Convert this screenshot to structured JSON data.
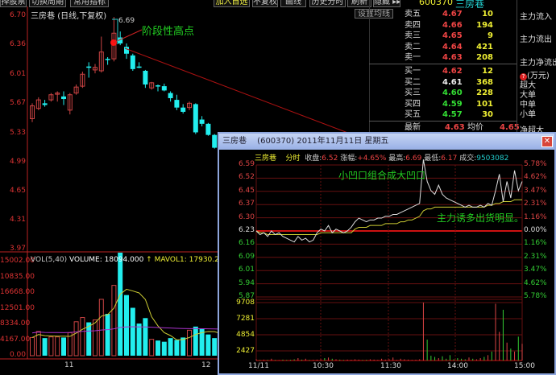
{
  "toolbar": {
    "select_stock": "择股票",
    "switch_period": "切换周期",
    "common_indicators": "常用指标",
    "add_favorite": "加入自选",
    "no_adjust": "不复权",
    "draw_line": "画线",
    "history_intraday": "历史分时",
    "refresh": "刷新",
    "hide": "隐藏 ▸▸",
    "set_ma": "设置均线"
  },
  "kline": {
    "title": "三房巷",
    "subtitle": "(日线,下复权)",
    "high_label": "6.69",
    "annotation": "阶段性高点",
    "y_ticks": [
      "6.70",
      "6.36",
      "6.01",
      "5.67",
      "5.33",
      "4.99",
      "4.65",
      "4.31",
      "3.97"
    ],
    "x_ticks": [
      "11",
      "12"
    ],
    "candles": [
      [
        5.5,
        5.65,
        5.68,
        5.46
      ],
      [
        5.62,
        5.72,
        5.75,
        5.6
      ],
      [
        5.68,
        5.66,
        5.72,
        5.64
      ],
      [
        5.72,
        5.78,
        5.8,
        5.7
      ],
      [
        5.79,
        5.8,
        5.82,
        5.7
      ],
      [
        5.76,
        5.73,
        5.82,
        5.66
      ],
      [
        5.6,
        5.78,
        5.8,
        5.55
      ],
      [
        5.8,
        5.87,
        5.9,
        5.78
      ],
      [
        5.88,
        6.02,
        6.05,
        5.86
      ],
      [
        6.11,
        6.1,
        6.16,
        5.98
      ],
      [
        6.07,
        6.1,
        6.14,
        6.03
      ],
      [
        6.06,
        6.28,
        6.46,
        6.04
      ],
      [
        6.2,
        6.19,
        6.22,
        6.13
      ],
      [
        6.2,
        6.5,
        6.69,
        6.17
      ],
      [
        6.45,
        6.38,
        6.52,
        6.36
      ],
      [
        6.34,
        6.26,
        6.38,
        6.2
      ],
      [
        6.24,
        6.08,
        6.26,
        6.06
      ],
      [
        6.11,
        6.1,
        6.16,
        6.09
      ],
      [
        6.06,
        5.9,
        6.07,
        5.86
      ],
      [
        5.86,
        5.92,
        5.93,
        5.84
      ],
      [
        5.89,
        5.88,
        5.9,
        5.82
      ],
      [
        5.88,
        5.83,
        5.91,
        5.82
      ],
      [
        5.8,
        5.74,
        5.82,
        5.7
      ],
      [
        5.72,
        5.63,
        5.78,
        5.6
      ],
      [
        5.63,
        5.58,
        5.67,
        5.56
      ],
      [
        5.63,
        5.68,
        5.7,
        5.6
      ],
      [
        5.67,
        5.34,
        5.68,
        5.32
      ],
      [
        5.49,
        5.44,
        5.53,
        5.41
      ],
      [
        5.44,
        5.31,
        5.45,
        5.3
      ],
      [
        5.31,
        5.16,
        5.32,
        5.15
      ],
      [
        5.2,
        5.26,
        5.28,
        5.15
      ]
    ]
  },
  "volume": {
    "title": "VOL(5,40)",
    "volume_label": "VOLUME: 18094.000",
    "mavol_label": "MAVOL1: 17930.200",
    "y_ticks": [
      "15002.00",
      "10835.00",
      "16668.00",
      "12501.00",
      "8334.00",
      "4167.00",
      "0.00"
    ],
    "values": [
      3000,
      4000,
      2900,
      3100,
      3100,
      3000,
      3800,
      5600,
      6300,
      5500,
      5900,
      9300,
      6900,
      11600,
      17000,
      10000,
      7900,
      5300,
      6200,
      2700,
      2500,
      2300,
      2900,
      2600,
      3000,
      4200,
      4800,
      4400,
      3500,
      2900,
      2700
    ]
  },
  "quote": {
    "code": "600370",
    "name": "三房巷",
    "asks": [
      {
        "label": "卖五",
        "price": "4.67",
        "vol": "10"
      },
      {
        "label": "卖四",
        "price": "4.66",
        "vol": "194"
      },
      {
        "label": "卖三",
        "price": "4.65",
        "vol": "9"
      },
      {
        "label": "卖二",
        "price": "4.64",
        "vol": "421"
      },
      {
        "label": "卖一",
        "price": "4.63",
        "vol": "208"
      }
    ],
    "bids": [
      {
        "label": "买一",
        "price": "4.62",
        "vol": "12"
      },
      {
        "label": "买二",
        "price": "4.61",
        "vol": "368"
      },
      {
        "label": "买三",
        "price": "4.60",
        "vol": "228"
      },
      {
        "label": "买四",
        "price": "4.59",
        "vol": "101"
      },
      {
        "label": "买五",
        "price": "4.57",
        "vol": "30"
      }
    ],
    "latest_label": "最新",
    "latest": "4.63",
    "avg_label": "均价",
    "avg": "4.65",
    "flow": {
      "in": "主力流入",
      "out": "主力流出",
      "net": "主力净流出",
      "unit": "(万元)",
      "super": "超大",
      "big": "大单",
      "mid": "中单",
      "small": "小单",
      "net_super": "净超大"
    }
  },
  "popup": {
    "title": "三房巷 　(600370) 2011年11月11日 星期五",
    "close_label": "✕",
    "info": {
      "name": "三房巷",
      "mode": "分时",
      "close_label": "收盘:",
      "close": "6.52",
      "chg_label": "涨幅:",
      "chg": "+4.65%",
      "high_label": "最高:",
      "high": "6.69",
      "low_label": "最低:",
      "low": "6.17",
      "vol_label": "成交:",
      "vol": "9503082"
    },
    "annot1": "小凹口组合成大凹口",
    "annot2": "主力诱多出货明显。"
  },
  "chart_data": {
    "type": "line",
    "title": "三房巷 分时 2011年11月11日",
    "y_ticks": [
      "6.59",
      "6.52",
      "6.45",
      "6.37",
      "6.30",
      "6.23",
      "6.16",
      "6.09",
      "6.01",
      "5.94",
      "5.87"
    ],
    "pct_ticks": [
      "5.78%",
      "4.62%",
      "3.47%",
      "2.31%",
      "1.16%",
      "0.00%",
      "1.16%",
      "2.31%",
      "3.47%",
      "4.62%",
      "5.78%"
    ],
    "vol_ticks": [
      "9708",
      "7281",
      "4854",
      "2427"
    ],
    "x_ticks": [
      "11/11",
      "10:30",
      "11:30",
      "14:00",
      "15:00"
    ],
    "pre_close": 6.23,
    "price": [
      6.23,
      6.21,
      6.22,
      6.2,
      6.23,
      6.21,
      6.22,
      6.2,
      6.19,
      6.18,
      6.17,
      6.2,
      6.18,
      6.19,
      6.17,
      6.18,
      6.22,
      6.24,
      6.23,
      6.26,
      6.22,
      6.24,
      6.23,
      6.22,
      6.23,
      6.25,
      6.28,
      6.3,
      6.29,
      6.28,
      6.29,
      6.29,
      6.3,
      6.3,
      6.31,
      6.31,
      6.32,
      6.32,
      6.33,
      6.34,
      6.35,
      6.36,
      6.37,
      6.38,
      6.62,
      6.5,
      6.45,
      6.43,
      6.48,
      6.43,
      6.41,
      6.4,
      6.39,
      6.38,
      6.37,
      6.36,
      6.37,
      6.36,
      6.36,
      6.37,
      6.36,
      6.38,
      6.37,
      6.45,
      6.54,
      6.39,
      6.5,
      6.41,
      6.56,
      6.45,
      6.5
    ],
    "avg": [
      6.23,
      6.22,
      6.22,
      6.21,
      6.21,
      6.21,
      6.21,
      6.21,
      6.21,
      6.21,
      6.21,
      6.21,
      6.21,
      6.21,
      6.21,
      6.21,
      6.21,
      6.22,
      6.22,
      6.22,
      6.22,
      6.22,
      6.22,
      6.22,
      6.22,
      6.22,
      6.24,
      6.25,
      6.25,
      6.25,
      6.26,
      6.26,
      6.26,
      6.26,
      6.27,
      6.27,
      6.27,
      6.27,
      6.28,
      6.28,
      6.29,
      6.29,
      6.3,
      6.31,
      6.34,
      6.35,
      6.35,
      6.36,
      6.36,
      6.36,
      6.36,
      6.36,
      6.36,
      6.36,
      6.36,
      6.36,
      6.36,
      6.36,
      6.36,
      6.36,
      6.36,
      6.37,
      6.37,
      6.38,
      6.38,
      6.39,
      6.39,
      6.39,
      6.4,
      6.4,
      6.4
    ],
    "volume": [
      200,
      100,
      150,
      120,
      300,
      100,
      80,
      150,
      100,
      120,
      200,
      400,
      150,
      300,
      100,
      120,
      150,
      200,
      400,
      500,
      300,
      200,
      150,
      100,
      150,
      120,
      200,
      150,
      100,
      120,
      200,
      150,
      100,
      300,
      150,
      200,
      500,
      100,
      300,
      200,
      150,
      100,
      120,
      200,
      9708,
      3500,
      800,
      600,
      400,
      700,
      300,
      900,
      200,
      400,
      300,
      200,
      500,
      300,
      200,
      400,
      600,
      900,
      1500,
      9500,
      4800,
      8500,
      3000,
      2000,
      1500,
      4000,
      2800
    ]
  }
}
